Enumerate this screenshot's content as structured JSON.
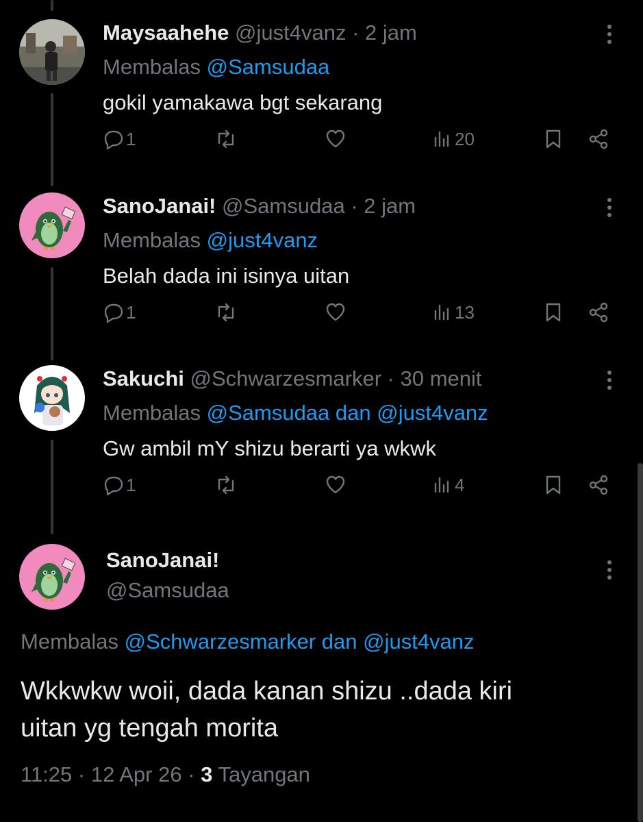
{
  "replies": [
    {
      "name": "Maysaahehe",
      "handle": "@just4vanz",
      "time": "2 jam",
      "reply_prefix": "Membalas",
      "reply_to": "@Samsudaa",
      "text": "gokil yamakawa bgt sekarang",
      "replies_count": "1",
      "views": "20",
      "avatar_icon": "person-photo-avatar"
    },
    {
      "name": "SanoJanai!",
      "handle": "@Samsudaa",
      "time": "2 jam",
      "reply_prefix": "Membalas",
      "reply_to": "@just4vanz",
      "text": "Belah dada ini isinya uitan",
      "replies_count": "1",
      "views": "13",
      "avatar_icon": "penguin-avatar"
    },
    {
      "name": "Sakuchi",
      "handle": "@Schwarzesmarker",
      "time": "30 menit",
      "reply_prefix": "Membalas",
      "reply_to": "@Samsudaa dan @just4vanz",
      "text": "Gw ambil mY shizu berarti ya wkwk",
      "replies_count": "1",
      "views": "4",
      "avatar_icon": "anime-girl-avatar"
    }
  ],
  "separator": "·",
  "main_tweet": {
    "name": "SanoJanai!",
    "handle": "@Samsudaa",
    "reply_prefix": "Membalas",
    "reply_to": "@Schwarzesmarker dan @just4vanz",
    "text_line1": "Wkkwkw woii, dada kanan shizu ..dada kiri",
    "text_line2": "uitan yg tengah morita",
    "time": "11:25",
    "date": "12 Apr 26",
    "views_count": "3",
    "views_label": "Tayangan"
  },
  "colors": {
    "background": "#000000",
    "text": "#e7e9ea",
    "muted": "#71767b",
    "link": "#1d9bf0",
    "avatar_pink": "#f28bbd"
  }
}
